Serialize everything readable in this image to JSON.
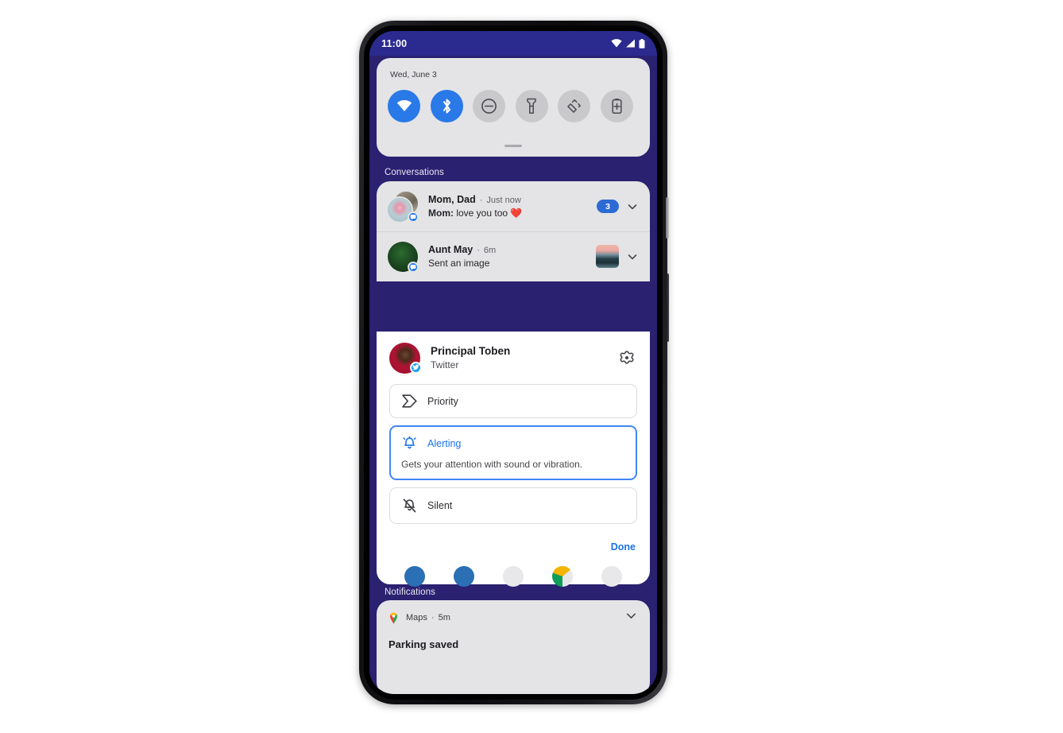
{
  "status_bar": {
    "time": "11:00",
    "icons": [
      "wifi-icon",
      "signal-icon",
      "battery-icon"
    ]
  },
  "quick_settings": {
    "date": "Wed, June 3",
    "tiles": [
      {
        "name": "wifi-tile",
        "icon": "wifi-icon",
        "active": true
      },
      {
        "name": "bluetooth-tile",
        "icon": "bluetooth-icon",
        "active": true
      },
      {
        "name": "dnd-tile",
        "icon": "do-not-disturb-icon",
        "active": false
      },
      {
        "name": "flashlight-tile",
        "icon": "flashlight-icon",
        "active": false
      },
      {
        "name": "auto-rotate-tile",
        "icon": "auto-rotate-icon",
        "active": false
      },
      {
        "name": "battery-saver-tile",
        "icon": "battery-saver-icon",
        "active": false
      }
    ]
  },
  "sections": {
    "conversations_label": "Conversations",
    "notifications_label": "Notifications"
  },
  "conversations": [
    {
      "name": "Mom, Dad",
      "separator": "·",
      "time": "Just now",
      "snippet_sender": "Mom:",
      "snippet_text": " love you too ❤️",
      "badge_count": "3",
      "has_thumbnail": false
    },
    {
      "name": "Aunt May",
      "separator": "·",
      "time": "6m",
      "snippet_sender": "",
      "snippet_text": "Sent an image",
      "badge_count": "",
      "has_thumbnail": true
    }
  ],
  "settings_panel": {
    "sender_name": "Principal Toben",
    "app_name": "Twitter",
    "gear_icon": "gear-icon",
    "twitter_badge_icon": "twitter-bird-icon",
    "options": [
      {
        "label": "Priority",
        "icon": "priority-arrow-icon",
        "description": "",
        "selected": false
      },
      {
        "label": "Alerting",
        "icon": "alerting-bell-icon",
        "description": "Gets your attention with sound or vibration.",
        "selected": true
      },
      {
        "label": "Silent",
        "icon": "bell-off-icon",
        "description": "",
        "selected": false
      }
    ],
    "done_label": "Done"
  },
  "bottom_notification": {
    "app_name": "Maps",
    "separator": "·",
    "time": "5m",
    "title": "Parking saved",
    "app_icon": "maps-pin-icon",
    "chevron_icon": "chevron-down-icon"
  },
  "colors": {
    "status_bar_blue": "#2a2a8f",
    "shade_background": "#2a2171",
    "panel_gray": "#e4e4e6",
    "panel_white": "#ffffff",
    "accent_blue": "#1a73e8",
    "selected_border": "#4285f4",
    "tile_active": "#2979e8",
    "badge_blue": "#2d6bd4"
  }
}
